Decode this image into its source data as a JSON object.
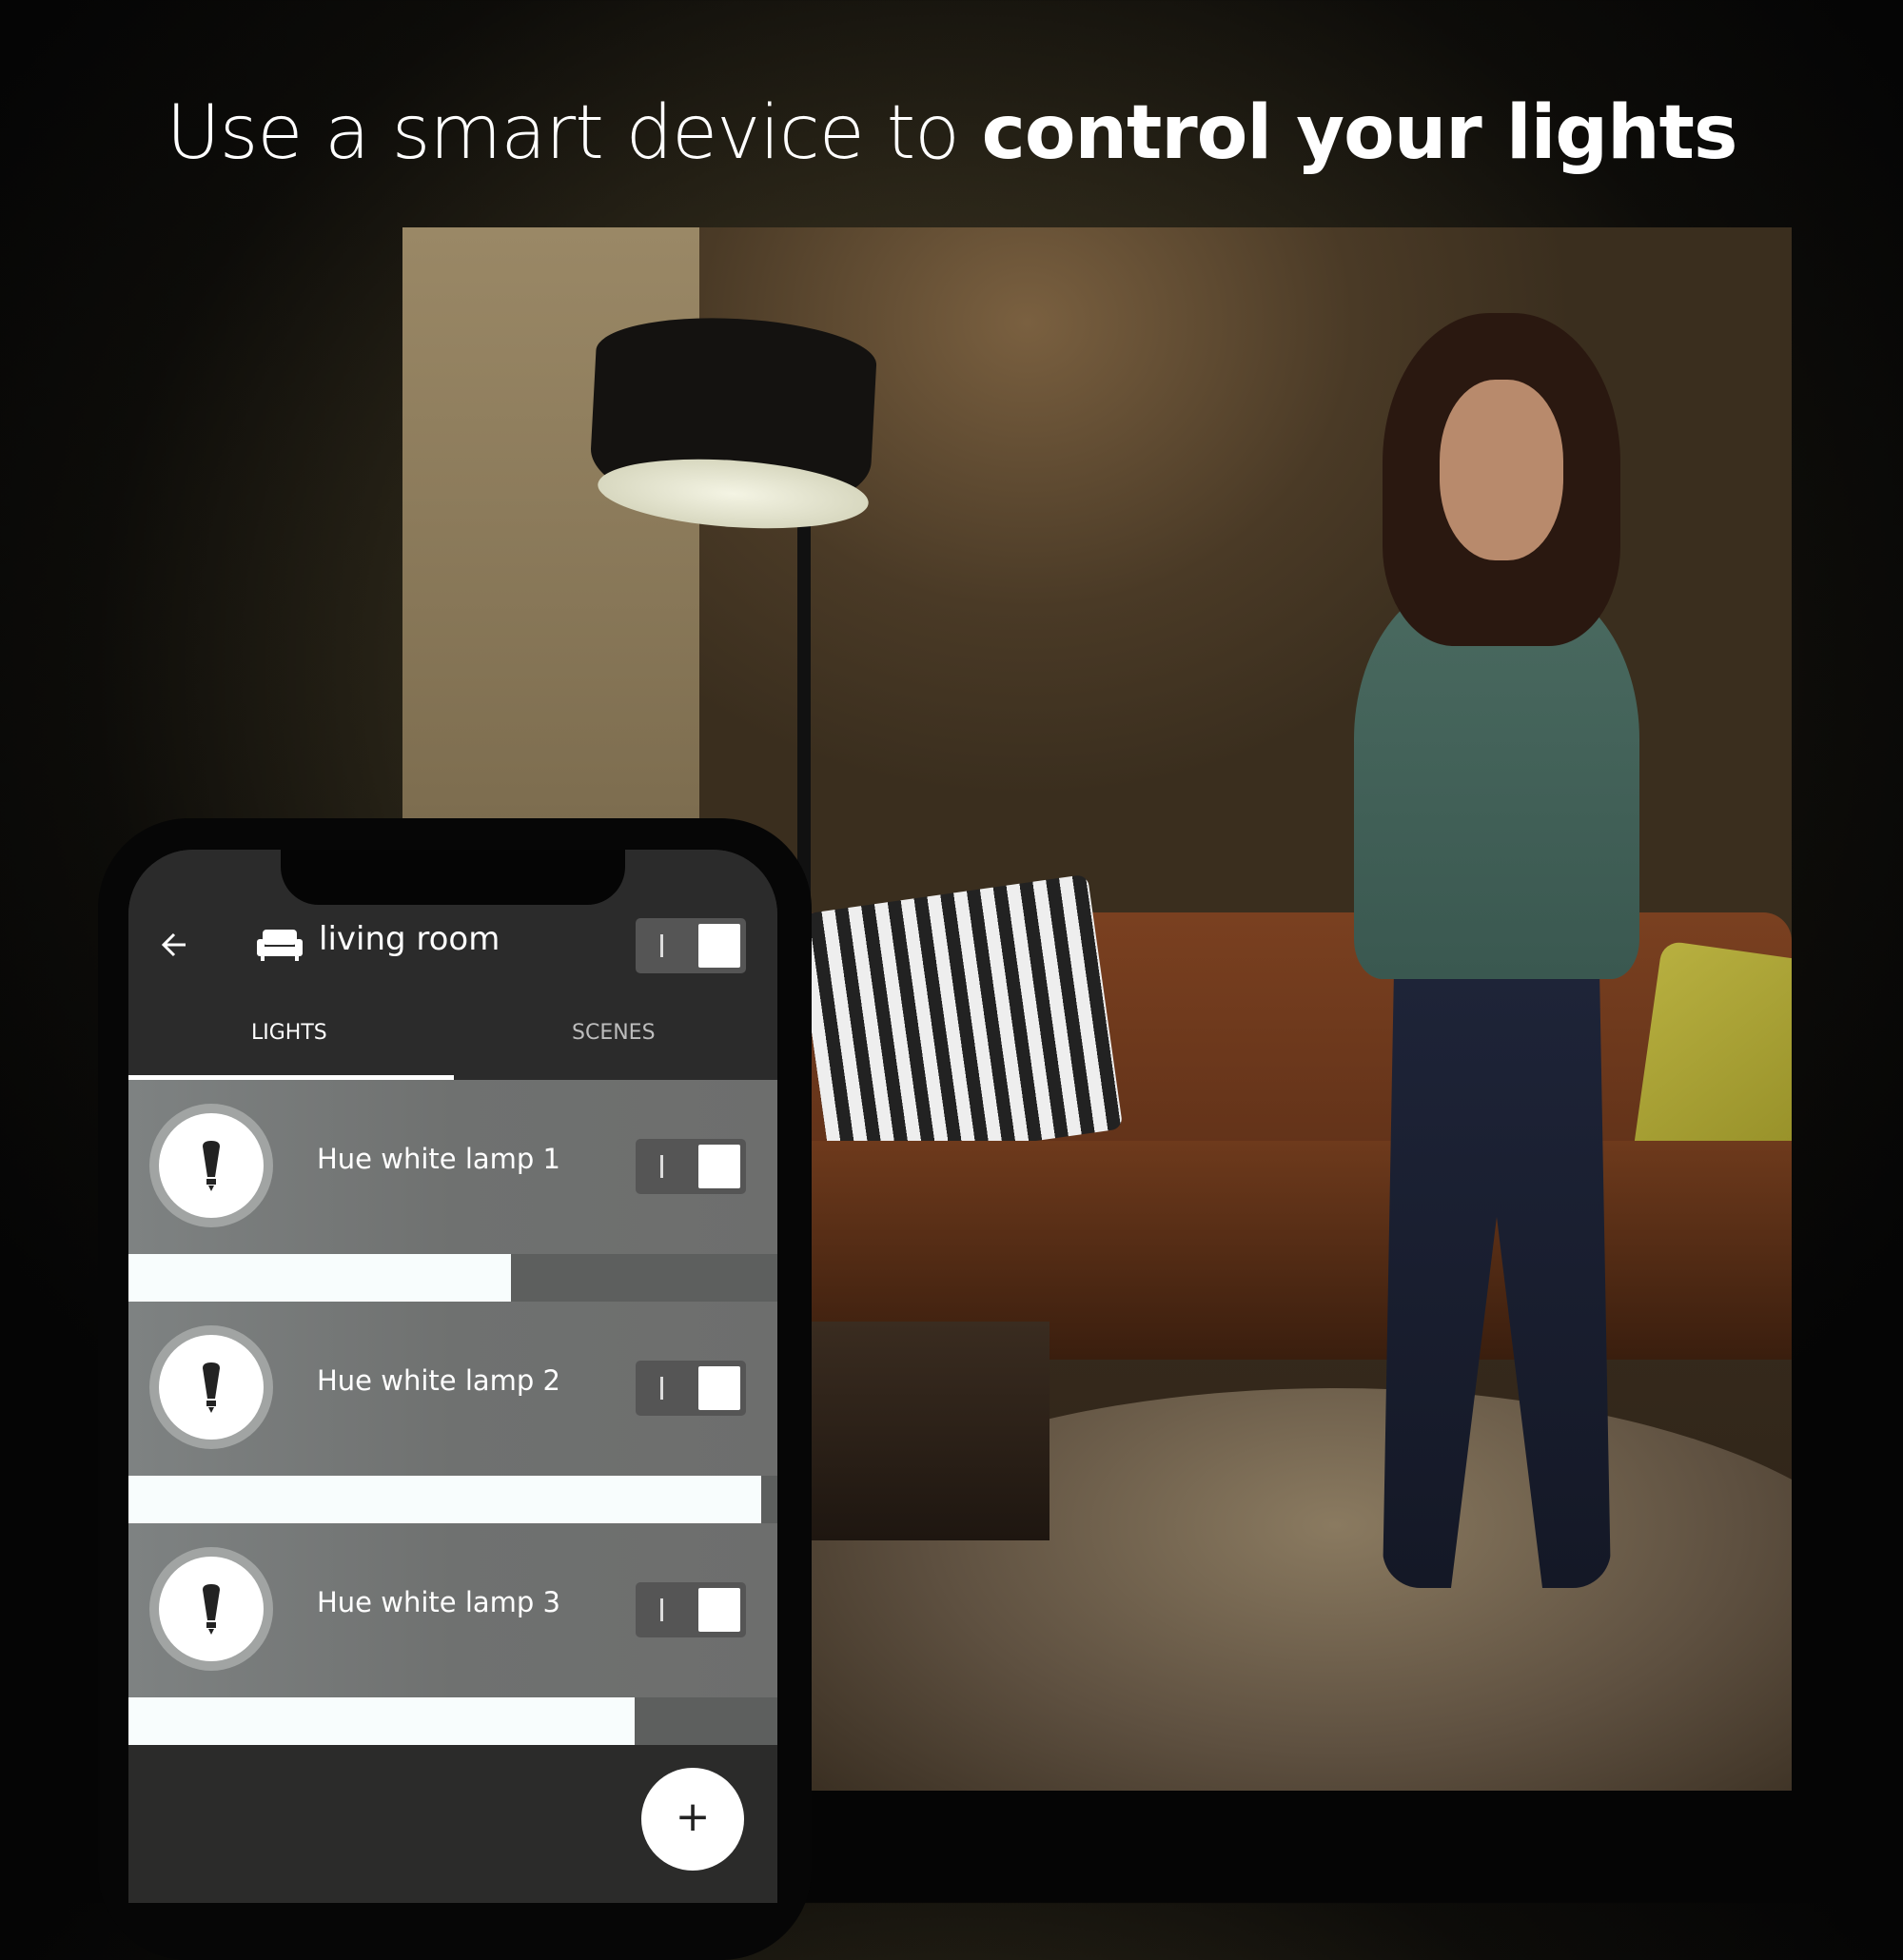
{
  "headline": {
    "regular": "Use a smart device to ",
    "bold": "control your lights"
  },
  "photo": {
    "description": "Woman standing in a living room looking at her phone, floor lamp lit, sofa and rug"
  },
  "app": {
    "header": {
      "back_icon": "arrow-left",
      "room_icon": "sofa",
      "room_name": "living room",
      "room_toggle_on": true,
      "toggle_glyph": "I"
    },
    "tabs": [
      {
        "label": "LIGHTS",
        "active": true
      },
      {
        "label": "SCENES",
        "active": false
      }
    ],
    "lights": [
      {
        "name": "Hue white lamp 1",
        "icon": "bulb",
        "on": true,
        "brightness": 0.59
      },
      {
        "name": "Hue white lamp 2",
        "icon": "bulb",
        "on": true,
        "brightness": 0.975
      },
      {
        "name": "Hue white lamp 3",
        "icon": "bulb",
        "on": true,
        "brightness": 0.78
      }
    ],
    "fab": {
      "icon": "plus",
      "label": "+"
    }
  },
  "colors": {
    "app_background": "#2b2b2b",
    "row_background": "#737675",
    "slider_fill": "#f8fdfd",
    "slider_track": "#5d5f5e",
    "toggle_track": "#555555"
  }
}
